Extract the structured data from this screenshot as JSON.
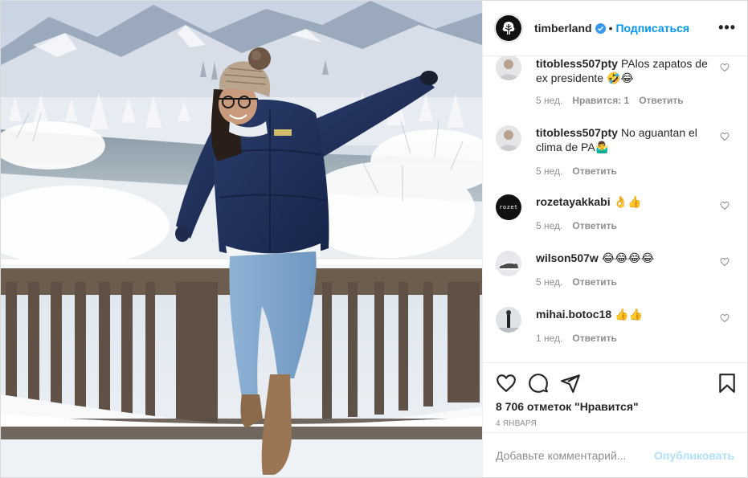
{
  "header": {
    "username": "timberland",
    "separator": "•",
    "follow_label": "Подписаться",
    "more_label": "•••"
  },
  "comments": [
    {
      "username": "titobless507pty",
      "text": "PAlos zapatos de ex presidente 🤣😂",
      "age": "5 нед.",
      "likes": "Нравится: 1",
      "reply": "Ответить"
    },
    {
      "username": "titobless507pty",
      "text": "No aguantan el clima de PA🤷‍♂️",
      "age": "5 нед.",
      "reply": "Ответить"
    },
    {
      "username": "rozetayakkabi",
      "text": "👌👍",
      "age": "5 нед.",
      "reply": "Ответить",
      "avatar_text": "rozet"
    },
    {
      "username": "wilson507w",
      "text": "😂😂😂😂",
      "age": "5 нед.",
      "reply": "Ответить"
    },
    {
      "username": "mihai.botoc18",
      "text": "👍👍",
      "age": "1 нед.",
      "reply": "Ответить"
    }
  ],
  "post": {
    "likes_text": "8 706 отметок \"Нравится\"",
    "date": "4 ЯНВАРЯ"
  },
  "composer": {
    "placeholder": "Добавьте комментарий...",
    "publish_label": "Опубликовать"
  },
  "icons": {
    "like": "heart-icon",
    "comment": "comment-icon",
    "share": "share-icon",
    "save": "bookmark-icon",
    "verified": "verified-badge-icon"
  },
  "colors": {
    "accent": "#0095f6",
    "publish_disabled": "#b2dffc",
    "meta": "#8e8e8e"
  }
}
